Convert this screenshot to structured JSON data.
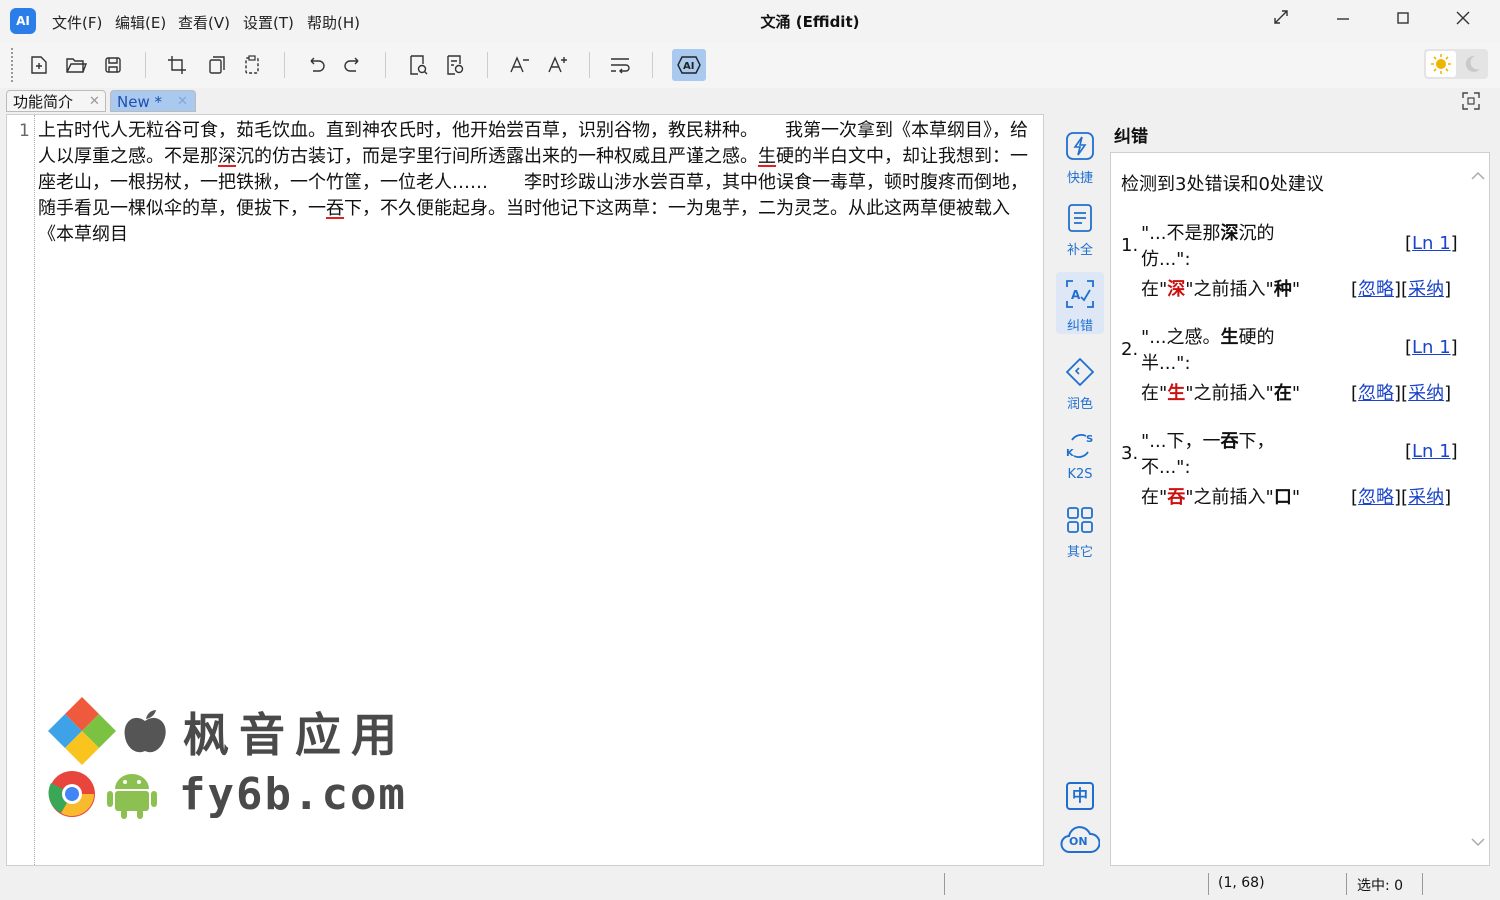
{
  "window": {
    "logo": "AI",
    "title": "文涌 (Effidit)",
    "menu": [
      "文件(F)",
      "编辑(E)",
      "查看(V)",
      "设置(T)",
      "帮助(H)"
    ]
  },
  "tabs": [
    {
      "label": "功能简介",
      "active": false
    },
    {
      "label": "New *",
      "active": true
    }
  ],
  "editor": {
    "line_number": "1",
    "segments": [
      {
        "t": "上古时代人无粒谷可食，茹毛饮血。直到神农氏时，他开始尝百草，识别谷物，教民耕种。　　我第一次拿到《本草纲目》，给人以厚重之感。不是那"
      },
      {
        "t": "深",
        "err": true
      },
      {
        "t": "沉的仿古装订，而是字里行间所透露出来的一种权威且严谨之感。"
      },
      {
        "t": "生",
        "err": true
      },
      {
        "t": "硬的半白文中，却让我想到：一座老山，一根拐杖，一把铁揪，一个竹筐，一位老人……　　李时珍跋山涉水尝百草，其中他误食一毒草，顿时腹疼而倒地，随手看见一棵似伞的草，便拔下，一"
      },
      {
        "t": "吞",
        "err": true
      },
      {
        "t": "下，不久便能起身。当时他记下这两草：一为鬼芋，二为灵芝。从此这两草便被载入《本草纲目"
      }
    ]
  },
  "watermark": {
    "line1": "枫音应用",
    "line2": "fy6b.com"
  },
  "sidebar": [
    {
      "label": "快捷",
      "icon": "lightning-icon"
    },
    {
      "label": "补全",
      "icon": "document-icon"
    },
    {
      "label": "纠错",
      "icon": "ai-check-icon",
      "active": true
    },
    {
      "label": "润色",
      "icon": "tag-icon"
    },
    {
      "label": "K2S",
      "icon": "k2s-icon"
    },
    {
      "label": "其它",
      "icon": "grid-icon"
    }
  ],
  "sidebar_bottom": {
    "lang": "中",
    "cloud": "ON"
  },
  "panel": {
    "title": "纠错",
    "summary": "检测到3处错误和0处建议",
    "issues": [
      {
        "num": "1.",
        "snip_a": "\"...不是那",
        "snip_b": "深",
        "snip_c": "沉的仿...\":",
        "ln": "Ln 1",
        "pre": "在\"",
        "target": "深",
        "mid": "\"之前插入\"",
        "insert": "种",
        "post": "\"",
        "ignore": "忽略",
        "accept": "采纳"
      },
      {
        "num": "2.",
        "snip_a": "\"...之感。",
        "snip_b": "生",
        "snip_c": "硬的半...\":",
        "ln": "Ln 1",
        "pre": "在\"",
        "target": "生",
        "mid": "\"之前插入\"",
        "insert": "在",
        "post": "\"",
        "ignore": "忽略",
        "accept": "采纳"
      },
      {
        "num": "3.",
        "snip_a": "\"...下，一",
        "snip_b": "吞",
        "snip_c": "下，不...\":",
        "ln": "Ln 1",
        "pre": "在\"",
        "target": "吞",
        "mid": "\"之前插入\"",
        "insert": "口",
        "post": "\"",
        "ignore": "忽略",
        "accept": "采纳"
      }
    ]
  },
  "status": {
    "position": "(1, 68)",
    "selection": "选中: 0"
  },
  "colors": {
    "accent": "#1f6fd1",
    "error": "#e02020"
  }
}
